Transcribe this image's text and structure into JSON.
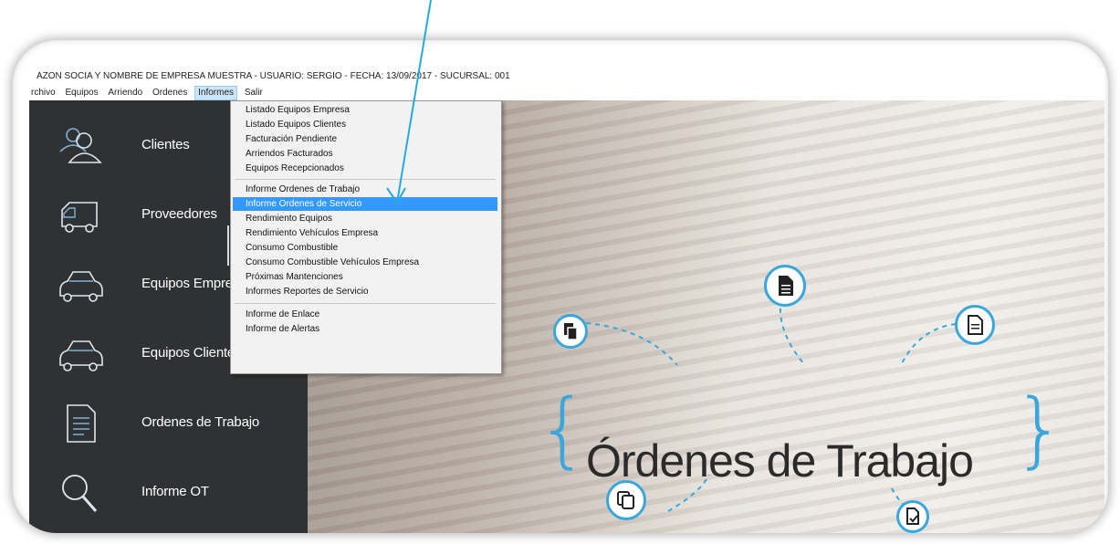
{
  "window": {
    "title": "AZON SOCIA Y NOMBRE DE EMPRESA MUESTRA - USUARIO: SERGIO - FECHA: 13/09/2017 - SUCURSAL: 001"
  },
  "menubar": {
    "items": [
      "rchivo",
      "Equipos",
      "Arriendo",
      "Ordenes",
      "Informes",
      "Salir"
    ],
    "active": "Informes"
  },
  "sidebar": {
    "items": [
      {
        "label": "Clientes",
        "icon": "users-icon"
      },
      {
        "label": "Proveedores",
        "icon": "truck-icon"
      },
      {
        "label": "Equipos Empre",
        "icon": "car-icon"
      },
      {
        "label": "Equipos Cliente",
        "icon": "car-icon"
      },
      {
        "label": "Ordenes de Trabajo",
        "icon": "document-icon"
      },
      {
        "label": "Informe OT",
        "icon": "magnifier-icon"
      }
    ]
  },
  "informes_menu": {
    "group1": [
      "Listado Equipos Empresa",
      "Listado Equipos Clientes",
      "Facturación Pendiente",
      "Arriendos Facturados",
      "Equipos Recepcionados"
    ],
    "group2": [
      "Informe Ordenes de Trabajo",
      "Informe Ordenes de Servicio",
      "Rendimiento Equipos",
      "Rendimiento Vehículos Empresa",
      "Consumo Combustible",
      "Consumo Combustible Vehículos Empresa",
      "Próximas Mantenciones",
      "Informes Reportes de Servicio"
    ],
    "group3": [
      "Informe de Enlace",
      "Informe de Alertas"
    ],
    "highlighted": "Informe Ordenes de Servicio"
  },
  "banner": {
    "title": "Órdenes de Trabajo",
    "brace_open": "{",
    "brace_close": "}",
    "accent_color": "#3aa6dc"
  },
  "annotation": {
    "arrow_color": "#29a8e0"
  }
}
